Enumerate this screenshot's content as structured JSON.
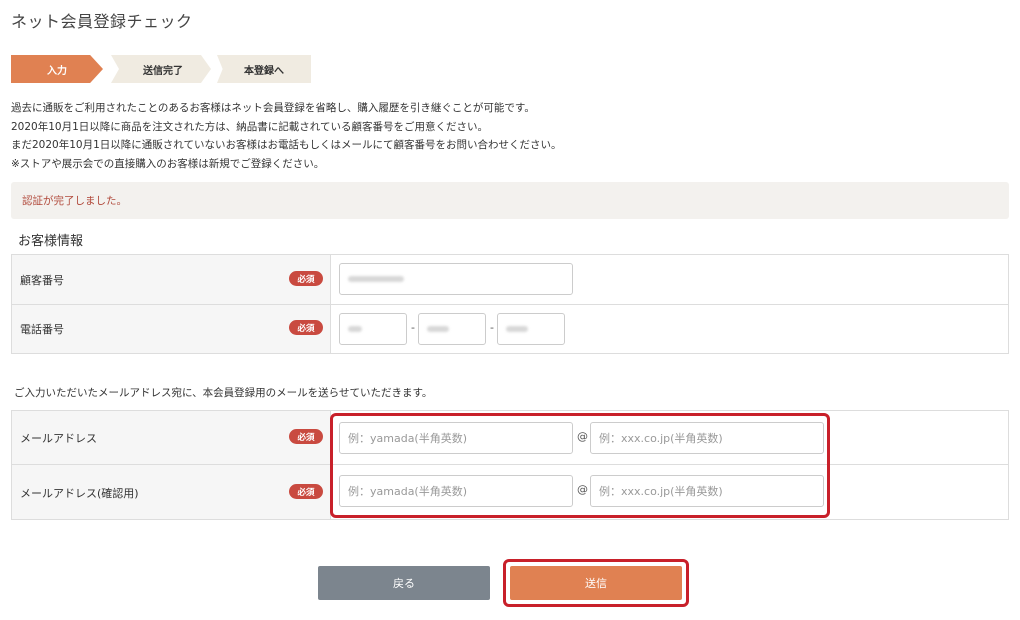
{
  "page": {
    "title": "ネット会員登録チェック"
  },
  "steps": [
    "入力",
    "送信完了",
    "本登録へ"
  ],
  "intro": [
    "過去に通販をご利用されたことのあるお客様はネット会員登録を省略し、購入履歴を引き継ぐことが可能です。",
    "2020年10月1日以降に商品を注文された方は、納品書に記載されている顧客番号をご用意ください。",
    "まだ2020年10月1日以降に通販されていないお客様はお電話もしくはメールにて顧客番号をお問い合わせください。",
    "※ストアや展示会での直接購入のお客様は新規でご登録ください。"
  ],
  "notice": "認証が完了しました。",
  "customer_section": {
    "title": "お客様情報",
    "required_badge": "必須",
    "customer_number_label": "顧客番号",
    "phone_label": "電話番号",
    "phone_separator": "-"
  },
  "email_section": {
    "note": "ご入力いただいたメールアドレス宛に、本会員登録用のメールを送らせていただきます。",
    "email_label": "メールアドレス",
    "email_confirm_label": "メールアドレス(確認用)",
    "local_placeholder": "例：yamada(半角英数)",
    "domain_placeholder": "例：xxx.co.jp(半角英数)",
    "at_sign": "@"
  },
  "buttons": {
    "back": "戻る",
    "send": "送信"
  },
  "colors": {
    "accent": "#e08152",
    "required": "#c94a40",
    "notice_text": "#b14a3c",
    "highlight": "#c8202a",
    "back_button": "#7c858e"
  }
}
